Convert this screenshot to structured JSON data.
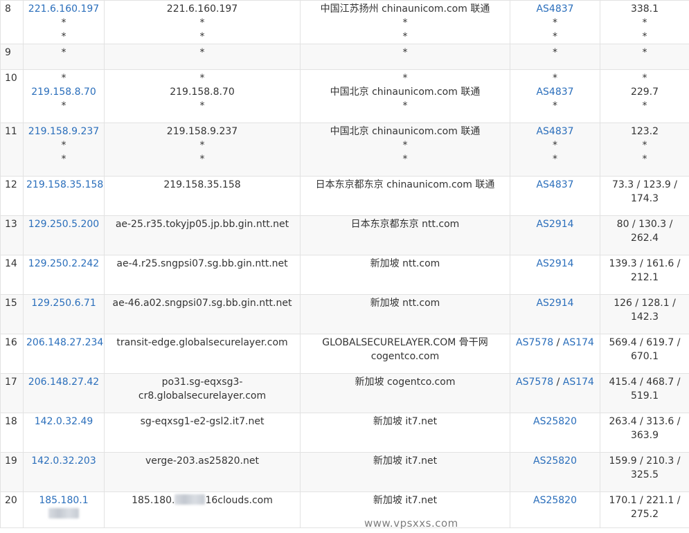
{
  "rows": [
    {
      "hop": "8",
      "ip": [
        "221.6.160.197",
        "*",
        "*"
      ],
      "host": [
        "221.6.160.197",
        "*",
        "*"
      ],
      "loc": [
        "中国江苏扬州 chinaunicom.com 联通",
        "*",
        "*"
      ],
      "asn": [
        [
          "AS4837"
        ],
        [
          "*"
        ],
        [
          "*"
        ]
      ],
      "rtt": [
        "338.1",
        "*",
        "*"
      ]
    },
    {
      "hop": "9",
      "ip": [
        "*"
      ],
      "host": [
        "*"
      ],
      "loc": [
        "*"
      ],
      "asn": [
        [
          "*"
        ]
      ],
      "rtt": [
        "*"
      ]
    },
    {
      "hop": "10",
      "ip": [
        "*",
        "219.158.8.70",
        "*"
      ],
      "host": [
        "*",
        "219.158.8.70",
        "*"
      ],
      "loc": [
        "*",
        "中国北京 chinaunicom.com 联通",
        "*"
      ],
      "asn": [
        [
          "*"
        ],
        [
          "AS4837"
        ],
        [
          "*"
        ]
      ],
      "rtt": [
        "*",
        "229.7",
        "*"
      ]
    },
    {
      "hop": "11",
      "ip": [
        "219.158.9.237",
        "*",
        "*"
      ],
      "host": [
        "219.158.9.237",
        "*",
        "*"
      ],
      "loc": [
        "中国北京 chinaunicom.com 联通",
        "*",
        "*"
      ],
      "asn": [
        [
          "AS4837"
        ],
        [
          "*"
        ],
        [
          "*"
        ]
      ],
      "rtt": [
        "123.2",
        "*",
        "*"
      ]
    },
    {
      "hop": "12",
      "ip": [
        "219.158.35.158"
      ],
      "host": [
        "219.158.35.158"
      ],
      "loc": [
        "日本东京都东京 chinaunicom.com 联通"
      ],
      "asn": [
        [
          "AS4837"
        ]
      ],
      "rtt": [
        "73.3 / 123.9 / 174.3"
      ]
    },
    {
      "hop": "13",
      "ip": [
        "129.250.5.200"
      ],
      "host": [
        "ae-25.r35.tokyjp05.jp.bb.gin.ntt.net"
      ],
      "loc": [
        "日本东京都东京 ntt.com"
      ],
      "asn": [
        [
          "AS2914"
        ]
      ],
      "rtt": [
        "80 / 130.3 / 262.4"
      ]
    },
    {
      "hop": "14",
      "ip": [
        "129.250.2.242"
      ],
      "host": [
        "ae-4.r25.sngpsi07.sg.bb.gin.ntt.net"
      ],
      "loc": [
        "新加坡 ntt.com"
      ],
      "asn": [
        [
          "AS2914"
        ]
      ],
      "rtt": [
        "139.3 / 161.6 / 212.1"
      ]
    },
    {
      "hop": "15",
      "ip": [
        "129.250.6.71"
      ],
      "host": [
        "ae-46.a02.sngpsi07.sg.bb.gin.ntt.net"
      ],
      "loc": [
        "新加坡 ntt.com"
      ],
      "asn": [
        [
          "AS2914"
        ]
      ],
      "rtt": [
        "126 / 128.1 / 142.3"
      ]
    },
    {
      "hop": "16",
      "ip": [
        "206.148.27.234"
      ],
      "host": [
        "transit-edge.globalsecurelayer.com"
      ],
      "loc": [
        "GLOBALSECURELAYER.COM 骨干网 cogentco.com"
      ],
      "asn": [
        [
          "AS7578",
          "AS174"
        ]
      ],
      "rtt": [
        "569.4 / 619.7 / 670.1"
      ]
    },
    {
      "hop": "17",
      "ip": [
        "206.148.27.42"
      ],
      "host": [
        "po31.sg-eqxsg3-cr8.globalsecurelayer.com"
      ],
      "loc": [
        "新加坡 cogentco.com"
      ],
      "asn": [
        [
          "AS7578",
          "AS174"
        ]
      ],
      "rtt": [
        "415.4 / 468.7 / 519.1"
      ]
    },
    {
      "hop": "18",
      "ip": [
        "142.0.32.49"
      ],
      "host": [
        "sg-eqxsg1-e2-gsl2.it7.net"
      ],
      "loc": [
        "新加坡 it7.net"
      ],
      "asn": [
        [
          "AS25820"
        ]
      ],
      "rtt": [
        "263.4 / 313.6 / 363.9"
      ]
    },
    {
      "hop": "19",
      "ip": [
        "142.0.32.203"
      ],
      "host": [
        "verge-203.as25820.net"
      ],
      "loc": [
        "新加坡 it7.net"
      ],
      "asn": [
        [
          "AS25820"
        ]
      ],
      "rtt": [
        "159.9 / 210.3 / 325.5"
      ]
    },
    {
      "hop": "20",
      "ip": [
        "185.180.1"
      ],
      "host": [
        "185.180.",
        "16clouds.com"
      ],
      "loc": [
        "新加坡 it7.net"
      ],
      "asn": [
        [
          "AS25820"
        ]
      ],
      "rtt": [
        "170.1 / 221.1 / 275.2"
      ],
      "redacted": true
    }
  ],
  "watermark": "www.vpsxxs.com"
}
